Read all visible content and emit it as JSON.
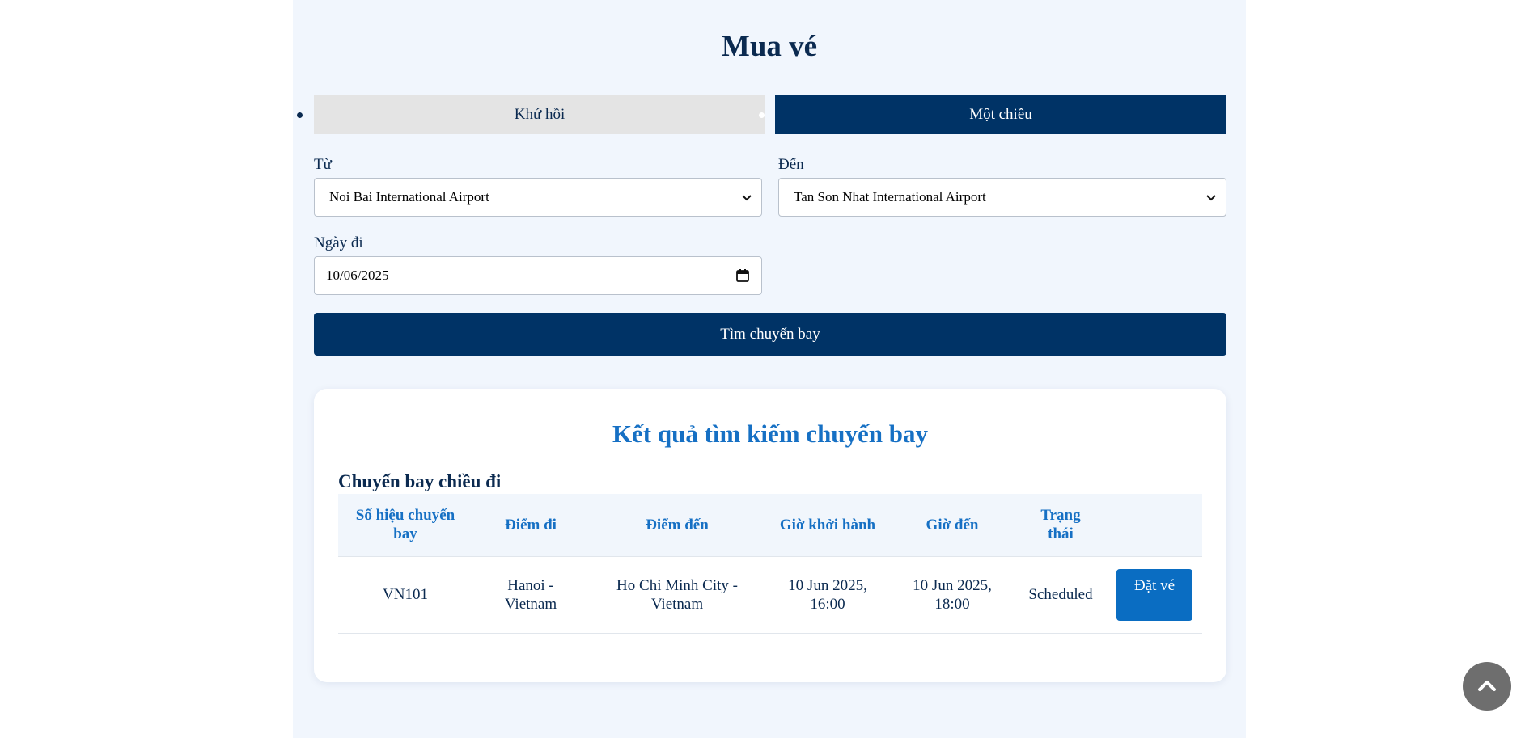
{
  "page": {
    "title": "Mua vé"
  },
  "tabs": [
    {
      "label": "Khứ hồi",
      "active": false
    },
    {
      "label": "Một chiều",
      "active": true
    }
  ],
  "form": {
    "from_label": "Từ",
    "from_value": "Noi Bai International Airport",
    "to_label": "Đến",
    "to_value": "Tan Son Nhat International Airport",
    "date_label": "Ngày đi",
    "date_value": "10/06/2025",
    "search_label": "Tìm chuyến bay"
  },
  "results": {
    "title": "Kết quả tìm kiếm chuyến bay",
    "section_title": "Chuyến bay chiều đi",
    "columns": [
      "Số hiệu chuyến bay",
      "Điểm đi",
      "Điểm đến",
      "Giờ khởi hành",
      "Giờ đến",
      "Trạng thái",
      ""
    ],
    "rows": [
      {
        "flight": "VN101",
        "from": "Hanoi - Vietnam",
        "to": "Ho Chi Minh City - Vietnam",
        "departure": "10 Jun 2025, 16:00",
        "arrival": "10 Jun 2025, 18:00",
        "status": "Scheduled",
        "action": "Đặt vé"
      }
    ]
  },
  "icons": {
    "select_chevron": "chevron-down-icon",
    "date_picker": "calendar-icon",
    "scroll_top": "chevron-up-icon"
  },
  "colors": {
    "primary": "#003366",
    "accent": "#1670c4",
    "panel_bg": "#f1f6fd"
  }
}
